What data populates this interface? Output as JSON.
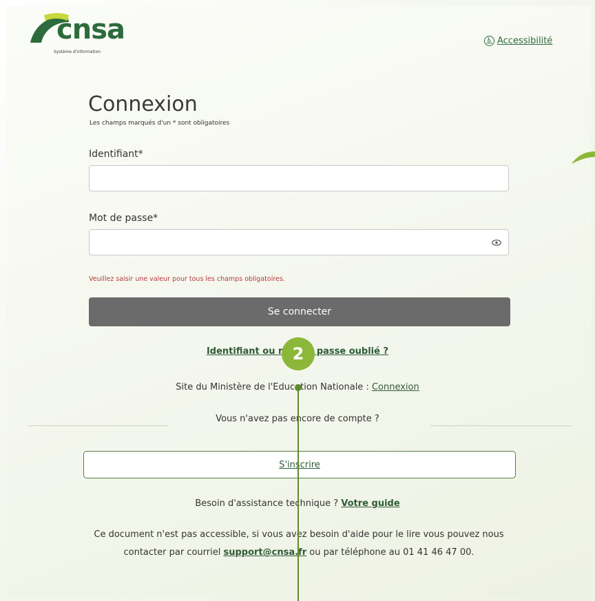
{
  "header": {
    "logo_text": "cnsa",
    "logo_subtitle": "Système d'information",
    "accessibility_label": "Accessibilité"
  },
  "login": {
    "title": "Connexion",
    "required_note": "Les champs marqués d'un * sont obligatoires",
    "username_label": "Identifiant*",
    "username_value": "",
    "password_label": "Mot de passe*",
    "password_value": "",
    "error_message": "Veuillez saisir une valeur pour tous les champs obligatoires.",
    "submit_label": "Se connecter",
    "forgot_link": "Identifiant ou mot de passe oublié ?"
  },
  "education": {
    "text": "Site du Ministère de l'Education Nationale : ",
    "link": "Connexion"
  },
  "register": {
    "prompt": "Vous n'avez pas encore de compte ?",
    "button_label": "S'inscrire"
  },
  "help": {
    "text": "Besoin d'assistance technique ? ",
    "link": "Votre guide"
  },
  "accessibility_note": {
    "text_before": "Ce document n'est pas accessible, si vous avez besoin d'aide pour le lire vous pouvez nous contacter par courriel ",
    "email": "support@cnsa.fr",
    "text_after": " ou par téléphone au 01 41 46 47 00."
  },
  "annotation": {
    "step_number": "2"
  },
  "colors": {
    "brand_green": "#2d6b3c",
    "accent_lime": "#8cb738",
    "button_gray": "#6b6b6b",
    "error_red": "#b63a3a"
  }
}
